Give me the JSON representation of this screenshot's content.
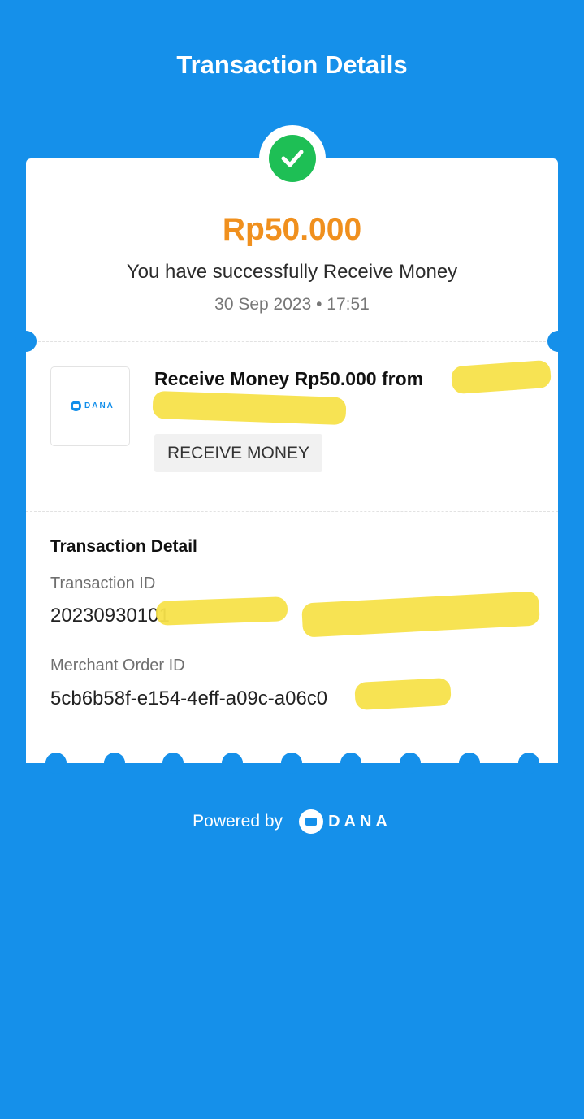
{
  "header": {
    "title": "Transaction Details"
  },
  "summary": {
    "amount": "Rp50.000",
    "message": "You have successfully Receive Money",
    "datetime": "30 Sep 2023 • 17:51",
    "status_icon": "check-circle-icon",
    "status_color": "#1EBF55",
    "amount_color": "#F0901E"
  },
  "merchant": {
    "logo_text": "DANA",
    "title": "Receive Money Rp50.000 from",
    "tag": "RECEIVE MONEY"
  },
  "details": {
    "heading": "Transaction Detail",
    "transaction_id_label": "Transaction ID",
    "transaction_id_value": "20230930101",
    "merchant_order_id_label": "Merchant Order ID",
    "merchant_order_id_value": "5cb6b58f-e154-4eff-a09c-a06c0"
  },
  "footer": {
    "powered_by": "Powered by",
    "brand": "DANA"
  },
  "colors": {
    "background": "#1590EA",
    "card": "#FFFFFF",
    "redaction": "#F7E24A"
  }
}
